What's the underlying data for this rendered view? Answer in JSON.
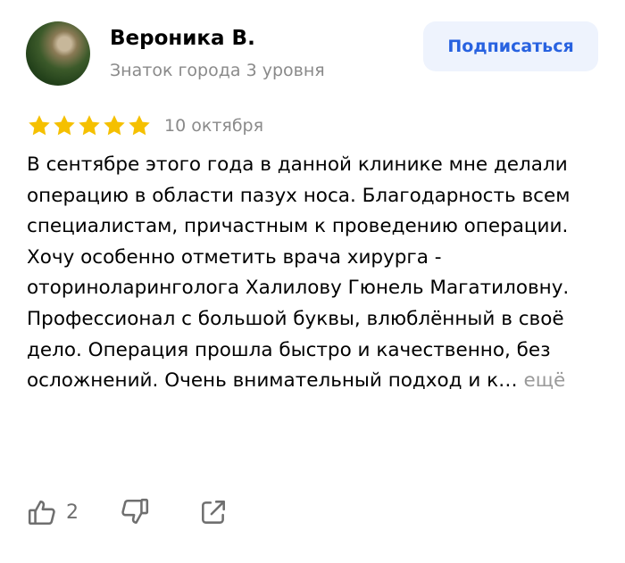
{
  "author": {
    "name": "Вероника В.",
    "level": "Знаток города 3 уровня",
    "avatar_icon": "avatar-photo"
  },
  "subscribe": {
    "label": "Подписаться"
  },
  "review": {
    "rating": 5,
    "rating_max": 5,
    "star_color": "#f5c000",
    "date": "10 октября",
    "text": "В сентябре этого года в данной клинике мне делали операцию в области пазух носа. Благодарность всем специалистам, причастным к проведению операции. Хочу особенно отметить врача хирурга - оториноларинголога Халилову Гюнель Магатиловну. Профессионал с большой буквы, влюблённый в своё дело.  Операция прошла быстро и качественно, без осложнений. Очень внимательный подход и к…",
    "more_label": "ещё"
  },
  "actions": {
    "like_icon": "thumbs-up-icon",
    "like_count": "2",
    "dislike_icon": "thumbs-down-icon",
    "share_icon": "share-icon"
  },
  "colors": {
    "accent": "#2862e0",
    "accent_bg": "#eef3fd",
    "muted": "#8a8a8a"
  }
}
